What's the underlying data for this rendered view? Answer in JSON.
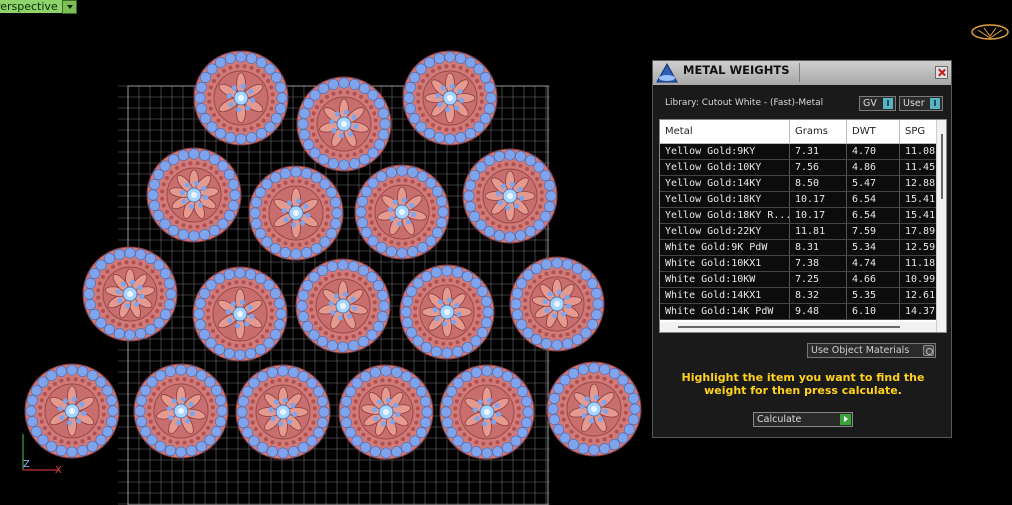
{
  "viewport": {
    "label": "Perspective",
    "axis_labels": {
      "z": "Z",
      "x": "X"
    }
  },
  "panel": {
    "title": "METAL WEIGHTS",
    "library": "Library: Cutout White - (Fast)-Metal",
    "toggles": [
      {
        "label": "GV",
        "indicator": "I"
      },
      {
        "label": "User",
        "indicator": "I"
      }
    ],
    "columns": [
      "Metal",
      "Grams",
      "DWT",
      "SPG"
    ],
    "rows": [
      [
        "Yellow Gold:9KY",
        "7.31",
        "4.70",
        "11.08"
      ],
      [
        "Yellow Gold:10KY",
        "7.56",
        "4.86",
        "11.45"
      ],
      [
        "Yellow Gold:14KY",
        "8.50",
        "5.47",
        "12.88"
      ],
      [
        "Yellow Gold:18KY",
        "10.17",
        "6.54",
        "15.41"
      ],
      [
        "Yellow Gold:18KY R...",
        "10.17",
        "6.54",
        "15.41"
      ],
      [
        "Yellow Gold:22KY",
        "11.81",
        "7.59",
        "17.89"
      ],
      [
        "White Gold:9K PdW",
        "8.31",
        "5.34",
        "12.59"
      ],
      [
        "White Gold:10KX1",
        "7.38",
        "4.74",
        "11.18"
      ],
      [
        "White Gold:10KW",
        "7.25",
        "4.66",
        "10.99"
      ],
      [
        "White Gold:14KX1",
        "8.32",
        "5.35",
        "12.61"
      ],
      [
        "White Gold:14K PdW",
        "9.48",
        "6.10",
        "14.37"
      ]
    ],
    "use_object_materials": "Use Object Materials",
    "instruction": "Highlight the item you want to find the weight for then press calculate.",
    "calculate": "Calculate"
  }
}
